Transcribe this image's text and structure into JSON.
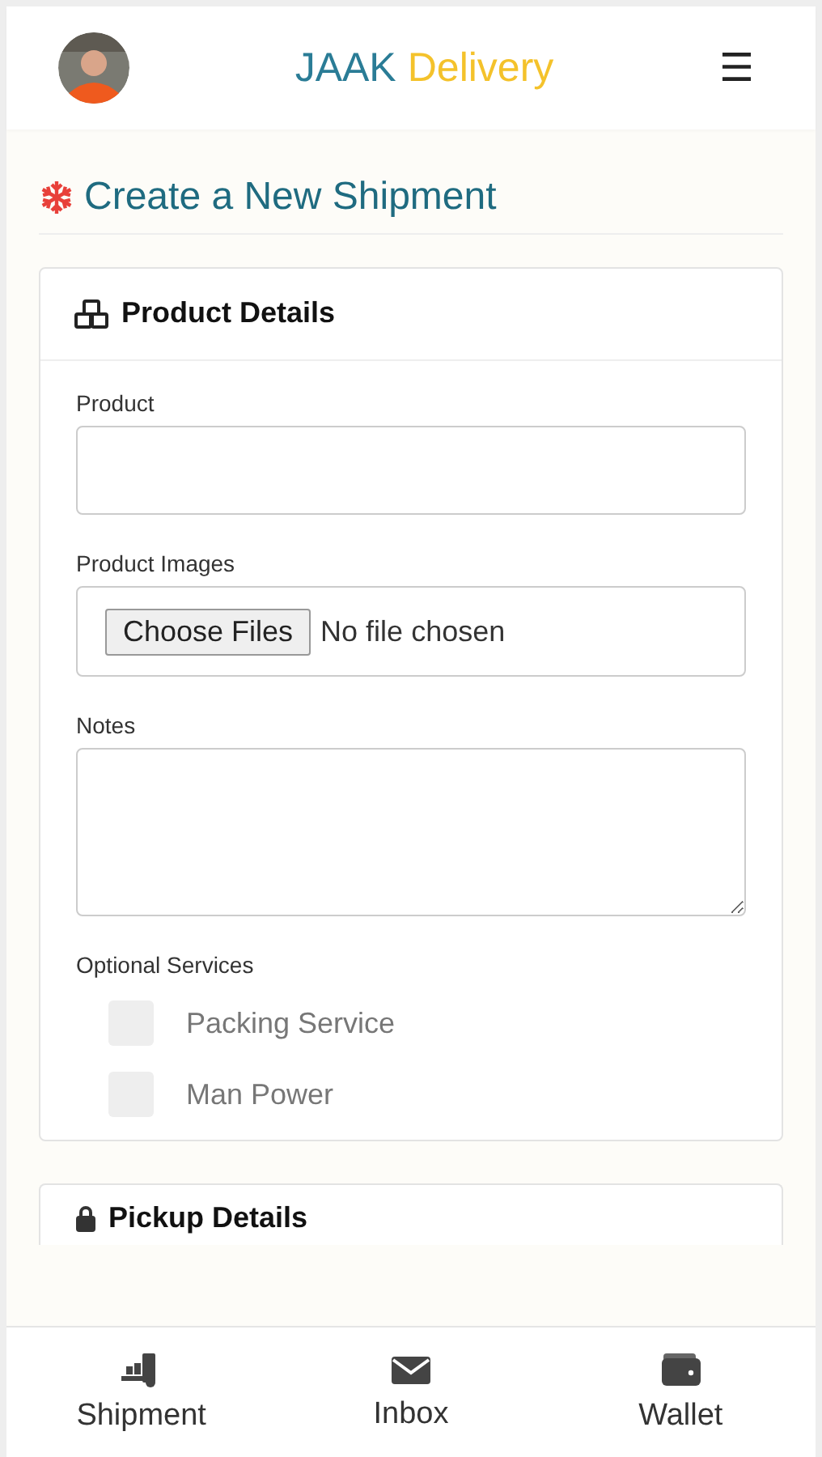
{
  "header": {
    "brand": "JAAK",
    "brand_accent": "Delivery",
    "menu_icon": "☰"
  },
  "page_title": "Create a New Shipment",
  "product_card": {
    "title": "Product Details",
    "fields": [
      {
        "kind": "text",
        "label": "Product"
      },
      {
        "kind": "file",
        "label": "Product Images",
        "button": "Choose Files",
        "status": "No file chosen"
      },
      {
        "kind": "textarea",
        "label": "Notes"
      }
    ],
    "services_label": "Optional Services",
    "services": [
      {
        "label": "Packing Service",
        "checked": false
      },
      {
        "label": "Man Power",
        "checked": false
      }
    ]
  },
  "next_card": {
    "title": "Pickup Details"
  },
  "bottom_nav": [
    {
      "kind": "shipment",
      "label": "Shipment"
    },
    {
      "kind": "inbox",
      "label": "Inbox"
    },
    {
      "kind": "wallet",
      "label": "Wallet"
    }
  ]
}
